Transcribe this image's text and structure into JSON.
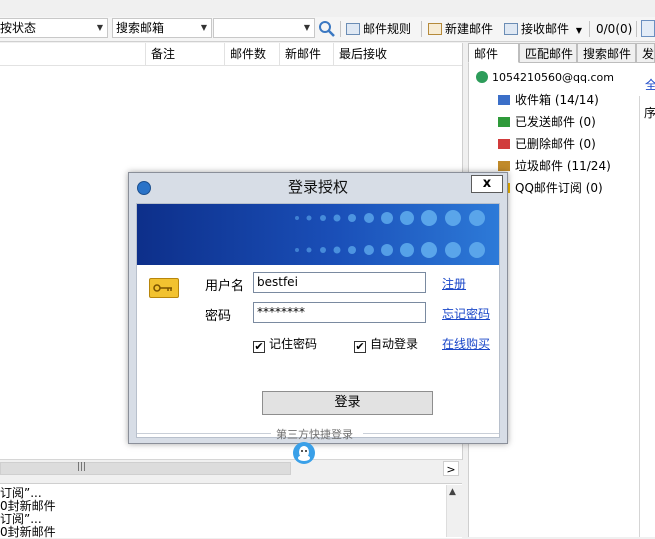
{
  "toolbar": {
    "status_filter": "按状态",
    "search_scope": "搜索邮箱",
    "search_value": "",
    "rules_label": "邮件规则",
    "new_mail_label": "新建邮件",
    "receive_label": "接收邮件",
    "counter": "0/0(0)"
  },
  "mail_list": {
    "columns": [
      "备注",
      "邮件数",
      "新邮件",
      "最后接收"
    ]
  },
  "log": {
    "lines": [
      "订阅”...",
      "0封新邮件",
      "订阅”...",
      "0封新邮件"
    ]
  },
  "right_panel": {
    "tabs": [
      "邮件",
      "匹配邮件",
      "搜索邮件",
      "发"
    ],
    "account": "1054210560@qq.com",
    "folders": [
      {
        "label": "收件箱 (14/14)",
        "icon": "inbox-icon",
        "color": "#3b6fc8"
      },
      {
        "label": "已发送邮件 (0)",
        "icon": "sent-icon",
        "color": "#2f9a3a"
      },
      {
        "label": "已删除邮件 (0)",
        "icon": "trash-icon",
        "color": "#d13b3b"
      },
      {
        "label": "垃圾邮件 (11/24)",
        "icon": "junk-icon",
        "color": "#c08a2a"
      },
      {
        "label": "QQ邮件订阅 (0)",
        "icon": "subscription-icon",
        "color": "#f0b400"
      }
    ],
    "side_label_top": "全",
    "side_label_2": "序"
  },
  "dialog": {
    "title": "登录授权",
    "close_label": "x",
    "username_label": "用户名",
    "username_value": "bestfei",
    "password_label": "密码",
    "password_value": "********",
    "register_link": "注册",
    "forgot_link": "忘记密码",
    "remember_label": "记住密码",
    "remember_checked": true,
    "autologin_label": "自动登录",
    "autologin_checked": true,
    "buy_link": "在线购买",
    "login_button": "登录",
    "third_party_label": "第三方快捷登录",
    "check_mark": "✔"
  },
  "colors": {
    "banner_dark": "#0d2f8a",
    "banner_light": "#2d7ad8",
    "link": "#1a47c8"
  }
}
